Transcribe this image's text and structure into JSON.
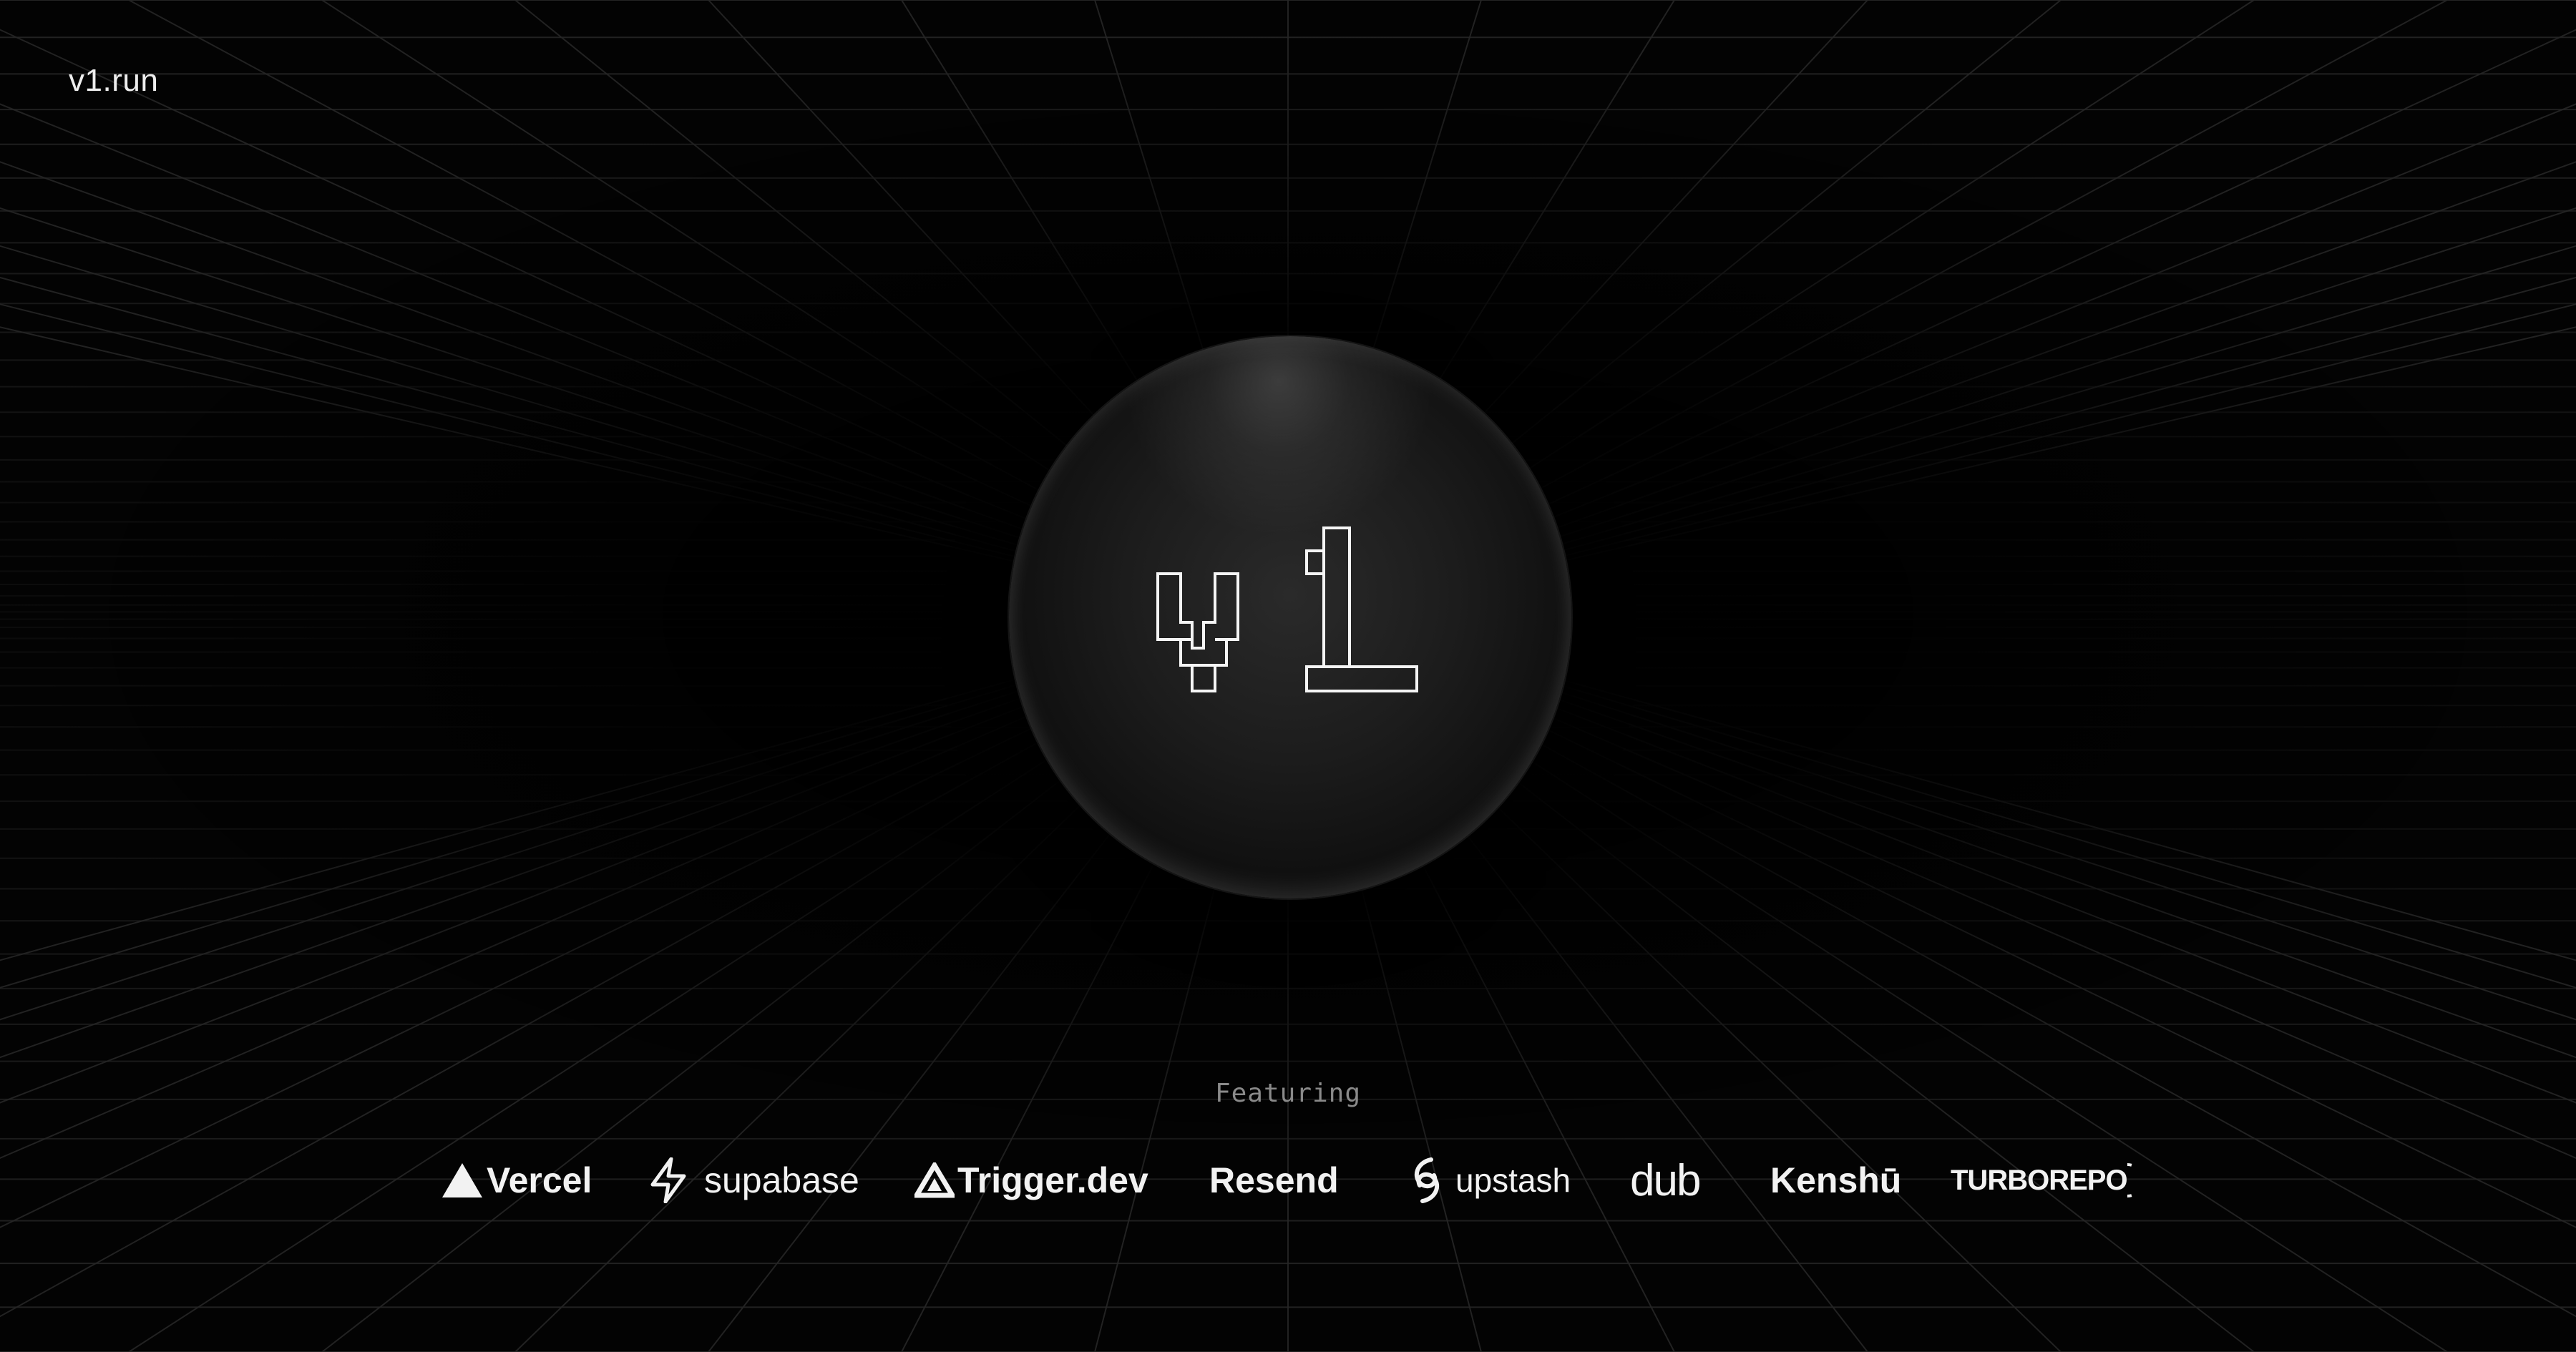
{
  "site": {
    "logo_text": "v1.run"
  },
  "hero": {
    "orb_mark_icon": "v1-pixel-outline-icon"
  },
  "featuring": {
    "label": "Featuring",
    "sponsors": [
      {
        "name": "Vercel",
        "icon": "vercel-triangle-icon"
      },
      {
        "name": "supabase",
        "icon": "supabase-bolt-icon"
      },
      {
        "name": "Trigger.dev",
        "icon": "trigger-triangle-icon"
      },
      {
        "name": "Resend",
        "icon": ""
      },
      {
        "name": "upstash",
        "icon": "upstash-swirl-icon"
      },
      {
        "name": "dub",
        "icon": ""
      },
      {
        "name": "Kenshū",
        "icon": ""
      },
      {
        "name": "TURBOREPO",
        "icon": "turborepo-ring-icon"
      }
    ]
  },
  "colors": {
    "background": "#000000",
    "grid_line": "#2a2a2a",
    "text": "#ededed",
    "muted_text": "#8a8a8a"
  }
}
